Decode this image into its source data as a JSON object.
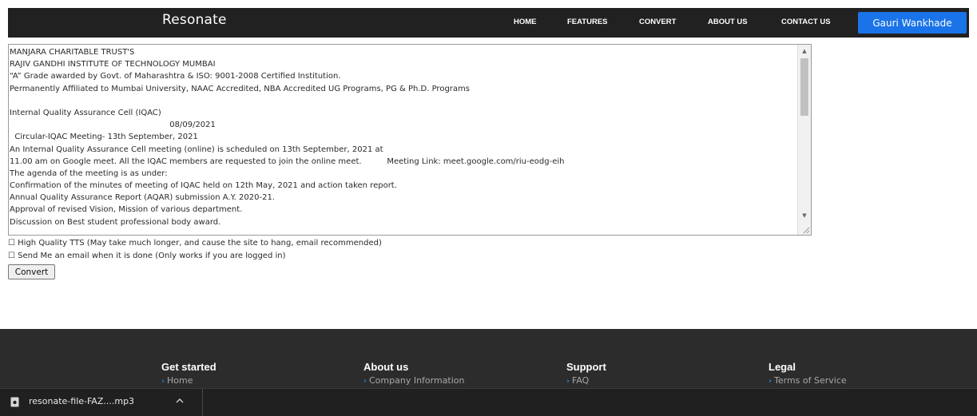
{
  "navbar": {
    "brand": "Resonate",
    "links": [
      "HOME",
      "FEATURES",
      "CONVERT",
      "ABOUT US",
      "CONTACT US"
    ],
    "user_button": "Gauri Wankhade",
    "accent_color": "#1a73e8"
  },
  "document": {
    "lines": [
      "MANJARA CHARITABLE TRUST'S",
      "RAJIV GANDHI INSTITUTE OF TECHNOLOGY MUMBAI",
      "“A” Grade awarded by Govt. of Maharashtra & ISO: 9001-2008 Certified Institution.",
      "Permanently Affiliated to Mumbai University, NAAC Accredited, NBA Accredited UG Programs, PG & Ph.D. Programs",
      "",
      "Internal Quality Assurance Cell (IQAC)",
      "                                                               08/09/2021",
      "  Circular-IQAC Meeting- 13th September, 2021",
      "An Internal Quality Assurance Cell meeting (online) is scheduled on 13th September, 2021 at",
      "11.00 am on Google meet. All the IQAC members are requested to join the online meet.          Meeting Link: meet.google.com/riu-eodg-eih",
      "The agenda of the meeting is as under:",
      "Confirmation of the minutes of meeting of IQAC held on 12th May, 2021 and action taken report.",
      "Annual Quality Assurance Report (AQAR) submission A.Y. 2020-21.",
      "Approval of revised Vision, Mission of various department.",
      "Discussion on Best student professional body award."
    ]
  },
  "options": {
    "high_quality_label": "High Quality TTS (May take much longer, and cause the site to hang, email recommended)",
    "email_label": "Send Me an email when it is done (Only works if you are logged in)",
    "convert_label": "Convert"
  },
  "footer": {
    "columns": [
      {
        "heading": "Get started",
        "link": "Home"
      },
      {
        "heading": "About us",
        "link": "Company Information"
      },
      {
        "heading": "Support",
        "link": "FAQ"
      },
      {
        "heading": "Legal",
        "link": "Terms of Service"
      }
    ]
  },
  "download_bar": {
    "file_name": "resonate-file-FAZ....mp3"
  }
}
